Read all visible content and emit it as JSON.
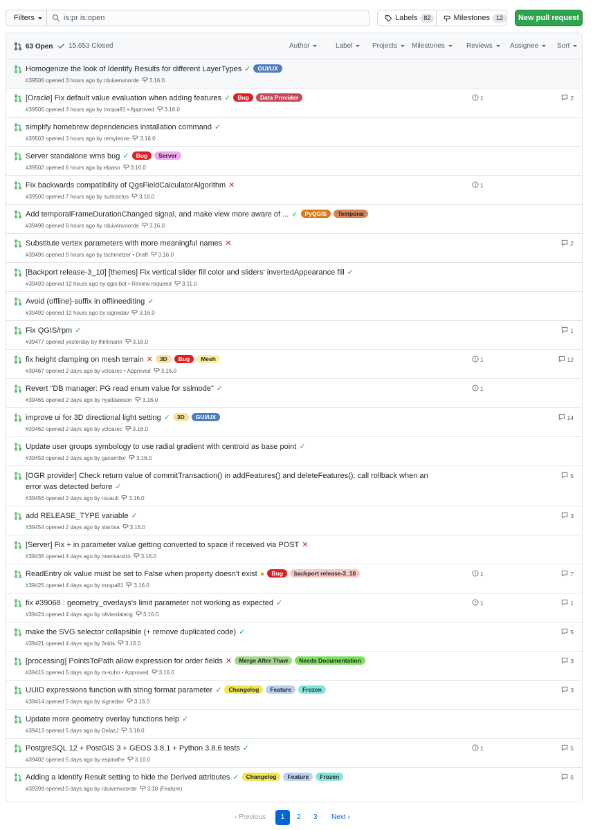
{
  "toolbar": {
    "filters_label": "Filters",
    "search_value": "is:pr is:open",
    "labels_label": "Labels",
    "labels_count": "82",
    "milestones_label": "Milestones",
    "milestones_count": "12",
    "new_pr_label": "New pull request"
  },
  "header": {
    "open": "63 Open",
    "closed": "15,653 Closed",
    "filters": [
      "Author",
      "Label",
      "Projects",
      "Milestones",
      "Reviews",
      "Assignee",
      "Sort"
    ]
  },
  "colors": {
    "green": "#28a745",
    "red": "#cb2431",
    "yellow": "#dbab09",
    "link_blue": "#0366d6",
    "button_green": "#2ea44f"
  },
  "prs": [
    {
      "title": "Homogenize the look of Identify Results for different LayerTypes",
      "status": "ok",
      "labels": [
        {
          "name": "GUI/UX",
          "bg": "#4f7dbf",
          "fg": "#ffffff"
        }
      ],
      "meta": "#39506 opened 3 hours ago by rduivenvoorde",
      "milestone": "3.16.0",
      "linked": "",
      "comments": "",
      "highlight": true
    },
    {
      "title": "[Oracle] Fix default value evaluation when adding features",
      "status": "ok",
      "labels": [
        {
          "name": "Bug",
          "bg": "#e11d21",
          "fg": "#ffffff"
        },
        {
          "name": "Data Provider",
          "bg": "#c8465a",
          "fg": "#ffffff"
        }
      ],
      "meta": "#39505 opened 3 hours ago by troopa81 • Approved",
      "milestone": "3.16.0",
      "linked": "1",
      "comments": "2"
    },
    {
      "title": "simplify homebrew dependencies installation command",
      "status": "ok",
      "labels": [],
      "meta": "#39503 opened 3 hours ago by remyleone",
      "milestone": "3.16.0",
      "linked": "",
      "comments": ""
    },
    {
      "title": "Server standalone wms bug",
      "status": "ok",
      "labels": [
        {
          "name": "Bug",
          "bg": "#e11d21",
          "fg": "#ffffff"
        },
        {
          "name": "Server",
          "bg": "#f1a7f0",
          "fg": "#24292e"
        }
      ],
      "meta": "#39502 opened 6 hours ago by elpaso",
      "milestone": "3.16.0",
      "linked": "",
      "comments": ""
    },
    {
      "title": "Fix backwards compatibility of QgsFieldCalculatorAlgorithm",
      "status": "fail",
      "labels": [],
      "meta": "#39500 opened 7 hours ago by suricactus",
      "milestone": "3.16.0",
      "linked": "1",
      "comments": ""
    },
    {
      "title": "Add temporalFrameDurationChanged signal, and make view more aware of ...",
      "status": "ok",
      "labels": [
        {
          "name": "PyQGIS",
          "bg": "#d87b1b",
          "fg": "#ffffff"
        },
        {
          "name": "Temporal",
          "bg": "#d6845a",
          "fg": "#24292e"
        }
      ],
      "meta": "#39498 opened 8 hours ago by rduivenvoorde",
      "milestone": "3.16.0",
      "linked": "",
      "comments": ""
    },
    {
      "title": "Substitute vertex parameters with more meaningful names",
      "status": "fail",
      "labels": [],
      "meta": "#39496 opened 9 hours ago by tschmetzer • Draft",
      "milestone": "3.16.0",
      "linked": "",
      "comments": "2"
    },
    {
      "title": "[Backport release-3_10] [themes] Fix vertical slider fill color and sliders' invertedAppearance fill",
      "status": "ok",
      "labels": [],
      "meta": "#39493 opened 12 hours ago by qgis-bot • Review required",
      "milestone": "3.11.0",
      "linked": "",
      "comments": ""
    },
    {
      "title": "Avoid (offline)-suffix in offlineediting",
      "status": "ok",
      "labels": [],
      "meta": "#39492 opened 12 hours ago by signedav",
      "milestone": "3.16.0",
      "linked": "",
      "comments": ""
    },
    {
      "title": "Fix QGIS/rpm",
      "status": "ok",
      "labels": [],
      "meta": "#39477 opened yesterday by lhirlimann",
      "milestone": "3.16.0",
      "linked": "",
      "comments": "1"
    },
    {
      "title": "fix height clamping on mesh terrain",
      "status": "fail",
      "labels": [
        {
          "name": "3D",
          "bg": "#f7e19c",
          "fg": "#24292e"
        },
        {
          "name": "Bug",
          "bg": "#e11d21",
          "fg": "#ffffff"
        },
        {
          "name": "Mesh",
          "bg": "#fbef9e",
          "fg": "#24292e"
        }
      ],
      "meta": "#39467 opened 2 days ago by vcloarec • Approved",
      "milestone": "3.16.0",
      "linked": "1",
      "comments": "12"
    },
    {
      "title": "Revert \"DB manager: PG read enum value for sslmode\"",
      "status": "ok",
      "labels": [],
      "meta": "#39465 opened 2 days ago by nyalldawson",
      "milestone": "3.16.0",
      "linked": "1",
      "comments": ""
    },
    {
      "title": "improve ui for 3D directional light setting",
      "status": "ok",
      "labels": [
        {
          "name": "3D",
          "bg": "#f7e19c",
          "fg": "#24292e"
        },
        {
          "name": "GUI/UX",
          "bg": "#4f7dbf",
          "fg": "#ffffff"
        }
      ],
      "meta": "#39462 opened 2 days ago by vcloarec",
      "milestone": "3.16.0",
      "linked": "",
      "comments": "14"
    },
    {
      "title": "Update user groups symbology to use radial gradient with centroid as base point",
      "status": "ok",
      "labels": [],
      "meta": "#39459 opened 2 days ago by gacarrillor",
      "milestone": "3.16.0",
      "linked": "",
      "comments": ""
    },
    {
      "title": "[OGR provider] Check return value of commitTransaction() in addFeatures() and deleteFeatures(); call rollback when an error was detected before",
      "status": "ok",
      "labels": [],
      "meta": "#39456 opened 2 days ago by rouault",
      "milestone": "3.16.0",
      "linked": "",
      "comments": "5",
      "tall": true
    },
    {
      "title": "add RELEASE_TYPE variable",
      "status": "ok",
      "labels": [],
      "meta": "#39454 opened 2 days ago by slarosa",
      "milestone": "3.16.0",
      "linked": "",
      "comments": "3"
    },
    {
      "title": "[Server] Fix + in parameter value getting converted to space if received via POST",
      "status": "fail",
      "labels": [],
      "meta": "#39436 opened 4 days ago by manisandro",
      "milestone": "3.16.0",
      "linked": "",
      "comments": ""
    },
    {
      "title": "ReadEntry ok value must be set to False when property doesn't exist",
      "status": "pend",
      "labels": [
        {
          "name": "Bug",
          "bg": "#e11d21",
          "fg": "#ffffff"
        },
        {
          "name": "backport release-3_10",
          "bg": "#f6c8c2",
          "fg": "#24292e"
        }
      ],
      "meta": "#39426 opened 4 days ago by troopa81",
      "milestone": "3.16.0",
      "linked": "1",
      "comments": "7"
    },
    {
      "title": "fix #39068 : geometry_overlays's limit parameter not working as expected",
      "status": "ok",
      "labels": [],
      "meta": "#39424 opened 4 days ago by olivierdalang",
      "milestone": "3.16.0",
      "linked": "1",
      "comments": "1"
    },
    {
      "title": "make the SVG selector collapsible (+ remove duplicated code)",
      "status": "ok",
      "labels": [],
      "meta": "#39421 opened 4 days ago by 3nids",
      "milestone": "3.16.0",
      "linked": "",
      "comments": "5"
    },
    {
      "title": "[processing] PointsToPath allow expression for order fields",
      "status": "fail",
      "labels": [
        {
          "name": "Merge After Thaw",
          "bg": "#a4d88a",
          "fg": "#24292e"
        },
        {
          "name": "Needs Documentation",
          "bg": "#7be05a",
          "fg": "#24292e"
        }
      ],
      "meta": "#39415 opened 5 days ago by m-kuhn • Approved",
      "milestone": "3.16.0",
      "linked": "",
      "comments": "3"
    },
    {
      "title": "UUID expressions function with string format parameter",
      "status": "ok",
      "labels": [
        {
          "name": "Changelog",
          "bg": "#f2e553",
          "fg": "#24292e"
        },
        {
          "name": "Feature",
          "bg": "#bcd0ef",
          "fg": "#24292e"
        },
        {
          "name": "Frozen",
          "bg": "#84e5da",
          "fg": "#24292e"
        }
      ],
      "meta": "#39414 opened 5 days ago by signedav",
      "milestone": "3.16.0",
      "linked": "",
      "comments": "3"
    },
    {
      "title": "Update more geometry overlay functions help",
      "status": "ok",
      "labels": [],
      "meta": "#39413 opened 5 days ago by DelazJ",
      "milestone": "3.16.0",
      "linked": "",
      "comments": ""
    },
    {
      "title": "PostgreSQL 12 + PostGIS 3 + GEOS 3.8.1 + Python 3.8.6 tests",
      "status": "ok",
      "labels": [],
      "meta": "#39402 opened 5 days ago by espinafre",
      "milestone": "3.16.0",
      "linked": "1",
      "comments": "5"
    },
    {
      "title": "Adding a Identify Result setting to hide the Derived attributes",
      "status": "ok",
      "labels": [
        {
          "name": "Changelog",
          "bg": "#f2e553",
          "fg": "#24292e"
        },
        {
          "name": "Feature",
          "bg": "#bcd0ef",
          "fg": "#24292e"
        },
        {
          "name": "Frozen",
          "bg": "#84e5da",
          "fg": "#24292e"
        }
      ],
      "meta": "#39399 opened 5 days ago by rduivenvoorde",
      "milestone": "3.18 (Feature)",
      "linked": "",
      "comments": "6"
    }
  ],
  "pagination": {
    "previous": "Previous",
    "pages": [
      "1",
      "2",
      "3"
    ],
    "current": "1",
    "next": "Next"
  }
}
